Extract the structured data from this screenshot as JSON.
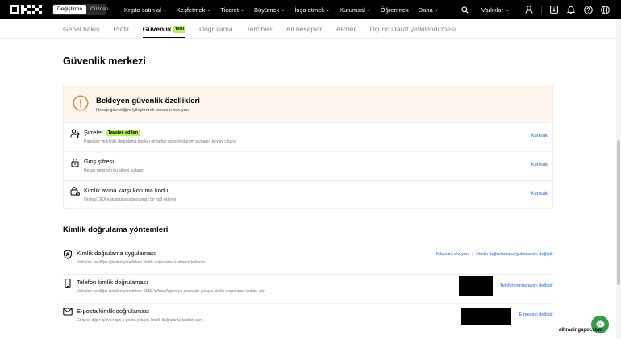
{
  "nav": {
    "logo": "OKX",
    "toggle": [
      "Değiştirme",
      "Cüzdan"
    ],
    "links": [
      {
        "label": "Kripto satın al",
        "chevron": true
      },
      {
        "label": "Keşfetmek",
        "chevron": true
      },
      {
        "label": "Ticaret",
        "chevron": true
      },
      {
        "label": "Büyümek",
        "chevron": true
      },
      {
        "label": "İnşa etmek",
        "chevron": true
      },
      {
        "label": "Kurumsal",
        "chevron": true
      },
      {
        "label": "Öğrenmek",
        "chevron": false
      },
      {
        "label": "Daha",
        "chevron": true
      }
    ],
    "assets_label": "Varlıklar",
    "icons": [
      "search-icon",
      "user-icon",
      "download-icon",
      "bell-icon",
      "help-icon",
      "globe-icon"
    ]
  },
  "tabs": [
    {
      "label": "Genel bakış",
      "active": false
    },
    {
      "label": "Profil",
      "active": false
    },
    {
      "label": "Güvenlik",
      "active": true,
      "badge": "Yeni"
    },
    {
      "label": "Doğrulama",
      "active": false
    },
    {
      "label": "Tercihler",
      "active": false
    },
    {
      "label": "Alt hesaplar",
      "active": false
    },
    {
      "label": "API'ler",
      "active": false
    },
    {
      "label": "Üçüncü taraf yetkilendirmesi",
      "active": false
    }
  ],
  "page": {
    "title": "Güvenlik merkezi"
  },
  "pending": {
    "title": "Bekleyen güvenlik özellikleri",
    "subtitle": "Hesap güvenliğini iyileştirerek paranızı koruyun",
    "items": [
      {
        "icon": "passkey-icon",
        "title": "Şifreler",
        "badge": "Tavsiye edilen",
        "desc": "Parolalar ve kimlik doğrulama kodları olmadan güvenli oturum açmanın keyfini çıkarın",
        "action": "Kurmak"
      },
      {
        "icon": "lock-icon",
        "title": "Giriş şifresi",
        "badge": "",
        "desc": "Hesap girişi için bu şifreyi kullanın",
        "action": "Kurmak"
      },
      {
        "icon": "anti-phishing-icon",
        "title": "Kimlik avına karşı koruma kodu",
        "badge": "",
        "desc": "Orijinal OKX e-postalarına benzersiz bir kod ekleyin",
        "action": "Kurmak"
      }
    ]
  },
  "methods": {
    "title": "Kimlik doğrulama yöntemleri",
    "items": [
      {
        "icon": "shield-icon",
        "title": "Kimlik doğrulama uygulaması",
        "desc": "Varlıkları ve diğer işlevleri yönetirken kimlik doğrulama kodlarını kullanın",
        "actions": [
          "Kılavuzu okuyun",
          "Kimlik doğrulama uygulamasını değiştir"
        ]
      },
      {
        "icon": "phone-icon",
        "title": "Telefon kimlik doğrulaması",
        "desc": "Varlıkları ve diğer işlevleri yönetirken SMS, WhatsApp veya aramalar yoluyla kimlik doğrulama kodları alın",
        "actions": [
          "Telefon numarasını değiştir"
        ]
      },
      {
        "icon": "mail-icon",
        "title": "E-posta kimlik doğrulaması",
        "desc": "Giriş ve diğer işlevler için e-posta yoluyla kimlik doğrulama kodları alın",
        "actions": [
          "E-postayı değiştir"
        ]
      }
    ]
  },
  "watermark": "alltradingspot.com",
  "colors": {
    "accent": "#b8f25a",
    "link": "#2463eb",
    "warning": "#e08a2a",
    "chat": "#2f9e44"
  }
}
